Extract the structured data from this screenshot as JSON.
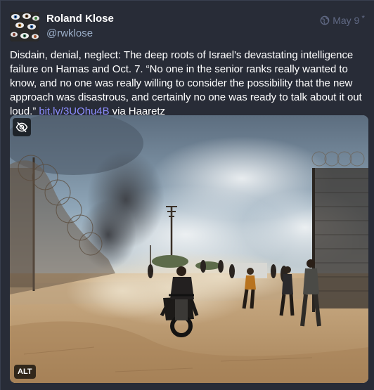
{
  "author": {
    "display_name": "Roland Klose",
    "handle": "@rwklose",
    "avatar_icon": "avatar-eyes-pattern"
  },
  "meta": {
    "visibility_icon": "globe-icon",
    "date": "May 9",
    "edited_marker": "*"
  },
  "post": {
    "text": "Disdain, denial, neglect: The deep roots of Israel's devastating intelligence failure on Hamas and Oct. 7. “No one in the senior ranks really wanted to know, and no one was really willing to consider the possibility that the new approach was disastrous, and certainly no one was ready to talk about it out loud.” ",
    "link_text": "bit.ly/3UQhu4B",
    "suffix": " via Haaretz"
  },
  "media": {
    "hide_icon": "eye-slash-icon",
    "alt_label": "ALT"
  },
  "colors": {
    "background": "#282c37",
    "link": "#8c8dff",
    "secondary_text": "#9baec8",
    "meta_text": "#606984"
  }
}
